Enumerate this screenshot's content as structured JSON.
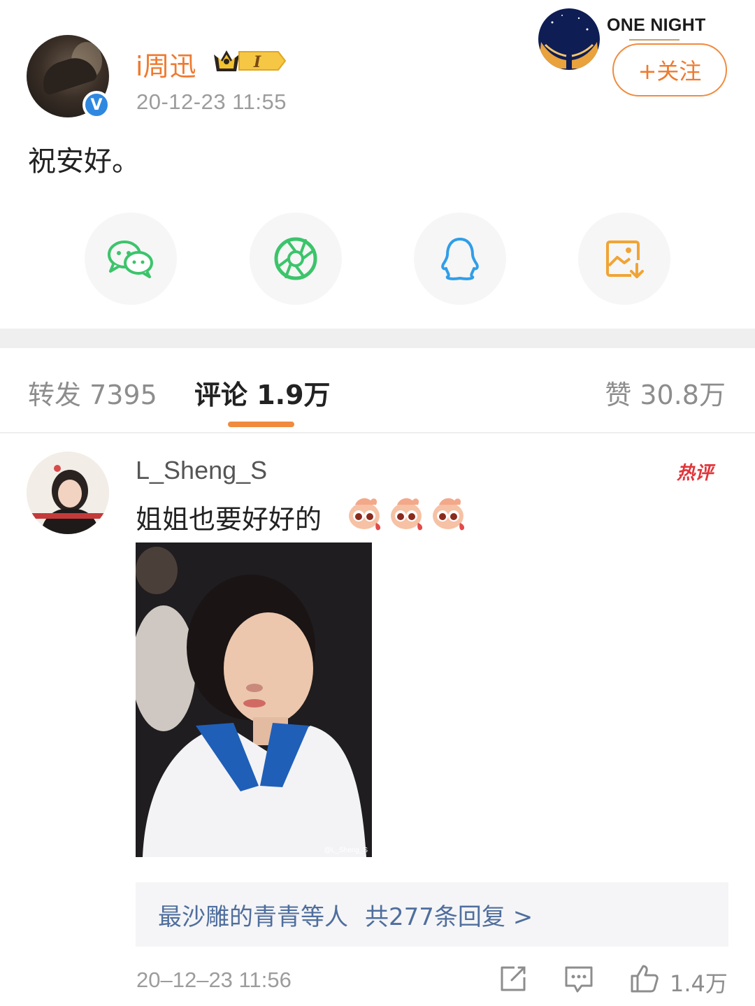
{
  "post": {
    "username": "i周迅",
    "vip_badge": "I",
    "time": "20-12-23 11:55",
    "verified": "V",
    "text": "祝安好。"
  },
  "branding": {
    "logo_text": "ONE NIGHT",
    "follow_label": "+关注"
  },
  "share": {
    "icons": [
      "wechat-icon",
      "moments-icon",
      "qq-icon",
      "save-image-icon"
    ]
  },
  "tabs": {
    "repost": "转发 7395",
    "comments": "评论 1.9万",
    "likes": "赞 30.8万"
  },
  "comment": {
    "username": "L_Sheng_S",
    "hot_label": "热评",
    "text": "姐姐也要好好的",
    "photo_watermark": "@L_Sheng_S",
    "replies_by": "最沙雕的青青等人",
    "replies_count": "共277条回复 >",
    "time": "20–12–23 11:56",
    "like_count": "1.4万"
  },
  "colors": {
    "accent": "#f08b3e",
    "username": "#ef7a2e",
    "link": "#4f6e9d",
    "hot": "#e2353a"
  }
}
